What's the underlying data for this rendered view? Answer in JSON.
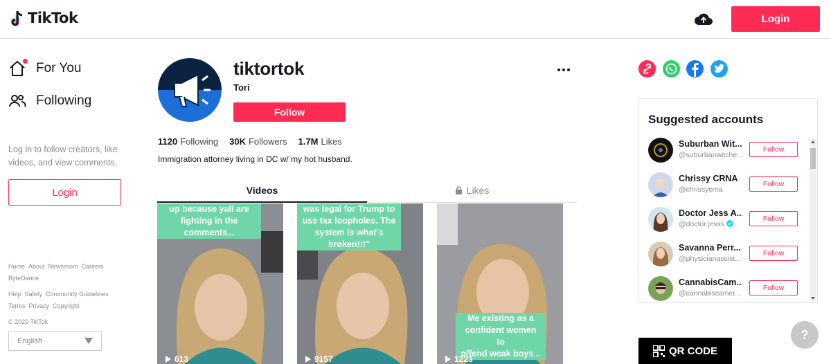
{
  "header": {
    "logo_text": "TikTok",
    "login_label": "Login",
    "upload_icon": "cloud-upload-icon"
  },
  "sidebar": {
    "nav": [
      {
        "label": "For You",
        "icon": "home-icon"
      },
      {
        "label": "Following",
        "icon": "people-icon"
      }
    ],
    "hint": "Log in to follow creators, like videos, and view comments.",
    "login_label": "Login",
    "footer_rows": [
      [
        "Home",
        "About",
        "Newsroom",
        "Careers"
      ],
      [
        "ByteDance"
      ],
      [
        "Help",
        "Safety",
        "Community Guidelines"
      ],
      [
        "Terms",
        "Privacy",
        "Copyright"
      ]
    ],
    "copyright": "© 2020 TikTok",
    "language": "English"
  },
  "profile": {
    "username": "tiktortok",
    "display_name": "Tori",
    "follow_label": "Follow",
    "stats": [
      {
        "value": "1120",
        "label": "Following"
      },
      {
        "value": "30K",
        "label": "Followers"
      },
      {
        "value": "1.7M",
        "label": "Likes"
      }
    ],
    "bio": "Immigration attorney living in DC w/ my hot husband."
  },
  "tabs": [
    {
      "label": "Videos",
      "active": true
    },
    {
      "label": "Likes",
      "active": false,
      "locked": true
    }
  ],
  "videos": [
    {
      "caption_lines": [
        "up because yall are",
        "fighting in the",
        "comments..."
      ],
      "views": "613"
    },
    {
      "caption_lines": [
        "was legal for Trump to",
        "use tax loopholes. The",
        "system is what's",
        "broken!!!\""
      ],
      "views": "9157"
    },
    {
      "caption_lines": [
        "Me existing as a",
        "confident women to",
        "offend weak boys..."
      ],
      "views": "1223"
    }
  ],
  "share": {
    "icons": [
      "link-icon",
      "whatsapp-icon",
      "facebook-icon",
      "twitter-icon"
    ],
    "colors": [
      "#fe2c55",
      "#25d366",
      "#1877f2",
      "#1da1f2"
    ]
  },
  "suggested": {
    "title": "Suggested accounts",
    "accounts": [
      {
        "name": "Suburban Wit...",
        "handle": "@suburbanwitche...",
        "follow_label": "Follow",
        "verified": false
      },
      {
        "name": "Chrissy CRNA",
        "handle": "@chrissycrna",
        "follow_label": "Follow",
        "verified": false
      },
      {
        "name": "Doctor Jess A...",
        "handle": "@doctor.jesss",
        "follow_label": "Follow",
        "verified": true
      },
      {
        "name": "Savanna Perr...",
        "handle": "@physicianassist...",
        "follow_label": "Follow",
        "verified": false
      },
      {
        "name": "CannabisCam...",
        "handle": "@cannabiscamer...",
        "follow_label": "Follow",
        "verified": false
      }
    ]
  },
  "qr_label": "QR CODE",
  "help_label": "?",
  "colors": {
    "accent": "#fe2c55",
    "caption_bg": "#6ed6a7",
    "avatar_blue": "#0a5dc2"
  }
}
